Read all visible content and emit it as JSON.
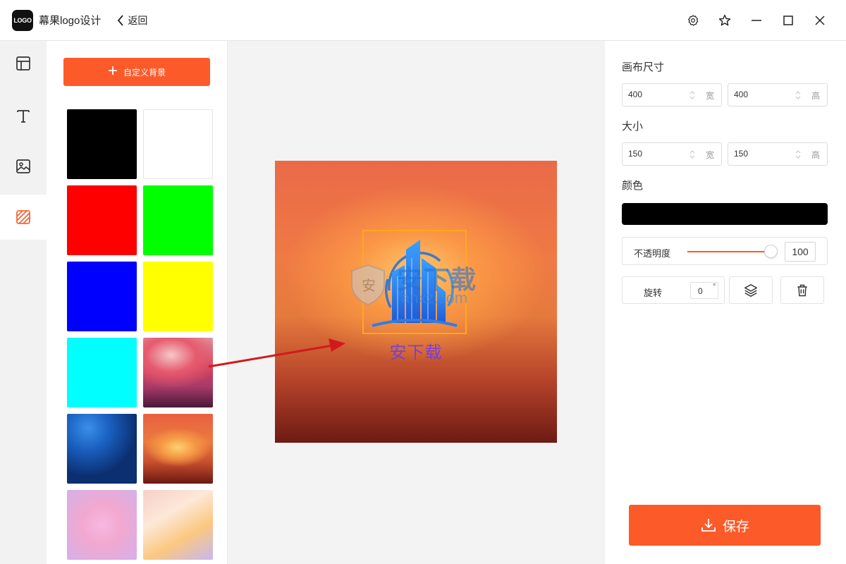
{
  "app": {
    "logo_text": "LOGO",
    "title": "幕果logo设计",
    "back_label": "返回"
  },
  "title_icons": [
    "settings-icon",
    "star-icon",
    "minimize-icon",
    "maximize-icon",
    "close-icon"
  ],
  "sidebar": {
    "items": [
      {
        "name": "template",
        "icon": "layout-icon",
        "active": false
      },
      {
        "name": "text",
        "icon": "text-icon",
        "active": false
      },
      {
        "name": "image",
        "icon": "image-icon",
        "active": false
      },
      {
        "name": "background",
        "icon": "background-pattern-icon",
        "active": true
      }
    ]
  },
  "background_panel": {
    "custom_button_label": "自定义背景",
    "swatches": [
      {
        "kind": "solid",
        "color": "#000000"
      },
      {
        "kind": "solid",
        "color": "#ffffff"
      },
      {
        "kind": "solid",
        "color": "#ff0000"
      },
      {
        "kind": "solid",
        "color": "#00ff00"
      },
      {
        "kind": "solid",
        "color": "#0000ff"
      },
      {
        "kind": "solid",
        "color": "#ffff00"
      },
      {
        "kind": "solid",
        "color": "#00ffff"
      },
      {
        "kind": "gradient",
        "color": "pink-purple-dusk"
      },
      {
        "kind": "gradient",
        "color": "blue-night"
      },
      {
        "kind": "gradient",
        "color": "orange-sunset"
      },
      {
        "kind": "gradient",
        "color": "pink-lilac"
      },
      {
        "kind": "gradient",
        "color": "peach-lavender"
      }
    ]
  },
  "canvas": {
    "logo_text": "安下载",
    "watermark_cn": "安下载",
    "watermark_en": "anxz.com"
  },
  "properties": {
    "canvas_size_label": "画布尺寸",
    "canvas_width": "400",
    "canvas_height": "400",
    "width_unit": "宽",
    "height_unit": "高",
    "size_label": "大小",
    "size_width": "150",
    "size_height": "150",
    "color_label": "颜色",
    "color_value": "#000000",
    "opacity_label": "不透明度",
    "opacity_value": "100",
    "rotate_label": "旋转",
    "rotate_value": "0",
    "rotate_unit": "°",
    "save_label": "保存"
  },
  "colors": {
    "accent": "#fd5a2a",
    "selection": "#ffa820",
    "logo_text": "#7b3fd0"
  }
}
